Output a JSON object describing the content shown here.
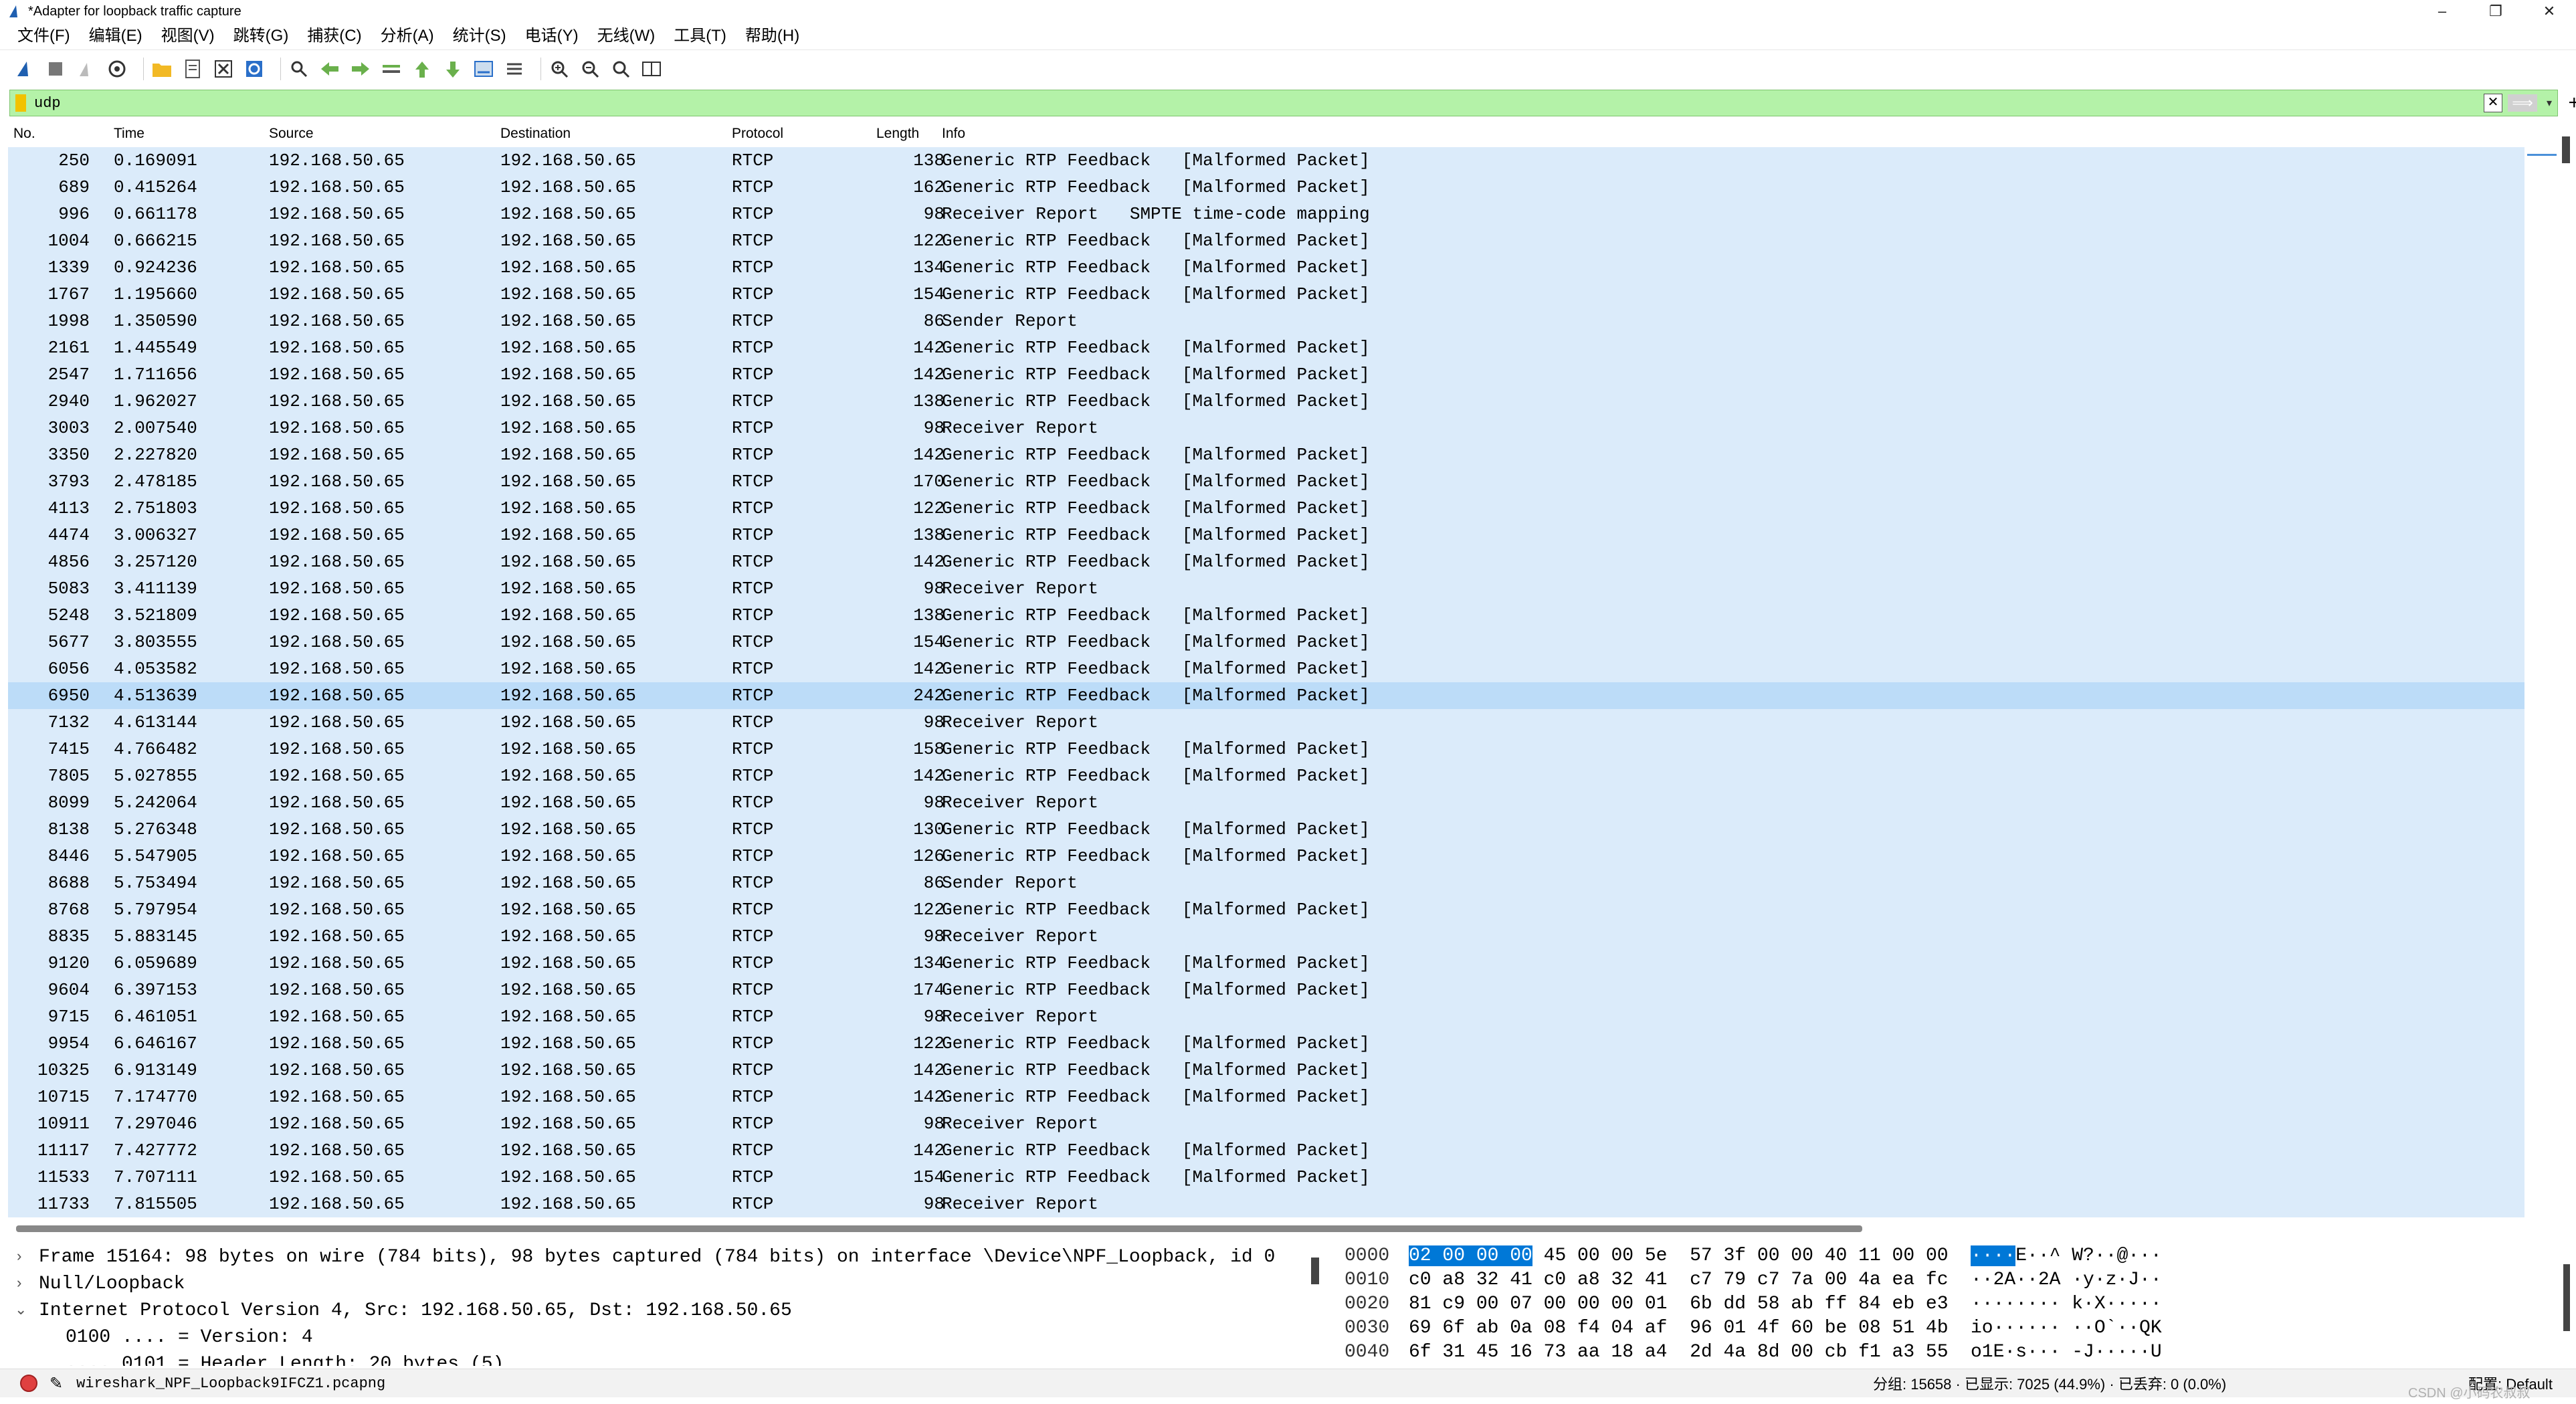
{
  "window": {
    "title": "*Adapter for loopback traffic capture",
    "controls": [
      "–",
      "❐",
      "✕"
    ]
  },
  "menu": [
    "文件(F)",
    "编辑(E)",
    "视图(V)",
    "跳转(G)",
    "捕获(C)",
    "分析(A)",
    "统计(S)",
    "电话(Y)",
    "无线(W)",
    "工具(T)",
    "帮助(H)"
  ],
  "filter": {
    "value": "udp",
    "clear": "✕",
    "apply": "⟹",
    "dropdown": "▾",
    "add": "+"
  },
  "columns": {
    "no": "No.",
    "time": "Time",
    "source": "Source",
    "destination": "Destination",
    "protocol": "Protocol",
    "length": "Length",
    "info": "Info"
  },
  "packets": [
    {
      "no": "250",
      "time": "0.169091",
      "src": "192.168.50.65",
      "dst": "192.168.50.65",
      "proto": "RTCP",
      "len": "138",
      "info": "Generic RTP Feedback   [Malformed Packet]"
    },
    {
      "no": "689",
      "time": "0.415264",
      "src": "192.168.50.65",
      "dst": "192.168.50.65",
      "proto": "RTCP",
      "len": "162",
      "info": "Generic RTP Feedback   [Malformed Packet]"
    },
    {
      "no": "996",
      "time": "0.661178",
      "src": "192.168.50.65",
      "dst": "192.168.50.65",
      "proto": "RTCP",
      "len": "98",
      "info": "Receiver Report   SMPTE time-code mapping"
    },
    {
      "no": "1004",
      "time": "0.666215",
      "src": "192.168.50.65",
      "dst": "192.168.50.65",
      "proto": "RTCP",
      "len": "122",
      "info": "Generic RTP Feedback   [Malformed Packet]"
    },
    {
      "no": "1339",
      "time": "0.924236",
      "src": "192.168.50.65",
      "dst": "192.168.50.65",
      "proto": "RTCP",
      "len": "134",
      "info": "Generic RTP Feedback   [Malformed Packet]"
    },
    {
      "no": "1767",
      "time": "1.195660",
      "src": "192.168.50.65",
      "dst": "192.168.50.65",
      "proto": "RTCP",
      "len": "154",
      "info": "Generic RTP Feedback   [Malformed Packet]"
    },
    {
      "no": "1998",
      "time": "1.350590",
      "src": "192.168.50.65",
      "dst": "192.168.50.65",
      "proto": "RTCP",
      "len": "86",
      "info": "Sender Report"
    },
    {
      "no": "2161",
      "time": "1.445549",
      "src": "192.168.50.65",
      "dst": "192.168.50.65",
      "proto": "RTCP",
      "len": "142",
      "info": "Generic RTP Feedback   [Malformed Packet]"
    },
    {
      "no": "2547",
      "time": "1.711656",
      "src": "192.168.50.65",
      "dst": "192.168.50.65",
      "proto": "RTCP",
      "len": "142",
      "info": "Generic RTP Feedback   [Malformed Packet]"
    },
    {
      "no": "2940",
      "time": "1.962027",
      "src": "192.168.50.65",
      "dst": "192.168.50.65",
      "proto": "RTCP",
      "len": "138",
      "info": "Generic RTP Feedback   [Malformed Packet]"
    },
    {
      "no": "3003",
      "time": "2.007540",
      "src": "192.168.50.65",
      "dst": "192.168.50.65",
      "proto": "RTCP",
      "len": "98",
      "info": "Receiver Report"
    },
    {
      "no": "3350",
      "time": "2.227820",
      "src": "192.168.50.65",
      "dst": "192.168.50.65",
      "proto": "RTCP",
      "len": "142",
      "info": "Generic RTP Feedback   [Malformed Packet]"
    },
    {
      "no": "3793",
      "time": "2.478185",
      "src": "192.168.50.65",
      "dst": "192.168.50.65",
      "proto": "RTCP",
      "len": "170",
      "info": "Generic RTP Feedback   [Malformed Packet]"
    },
    {
      "no": "4113",
      "time": "2.751803",
      "src": "192.168.50.65",
      "dst": "192.168.50.65",
      "proto": "RTCP",
      "len": "122",
      "info": "Generic RTP Feedback   [Malformed Packet]"
    },
    {
      "no": "4474",
      "time": "3.006327",
      "src": "192.168.50.65",
      "dst": "192.168.50.65",
      "proto": "RTCP",
      "len": "138",
      "info": "Generic RTP Feedback   [Malformed Packet]"
    },
    {
      "no": "4856",
      "time": "3.257120",
      "src": "192.168.50.65",
      "dst": "192.168.50.65",
      "proto": "RTCP",
      "len": "142",
      "info": "Generic RTP Feedback   [Malformed Packet]"
    },
    {
      "no": "5083",
      "time": "3.411139",
      "src": "192.168.50.65",
      "dst": "192.168.50.65",
      "proto": "RTCP",
      "len": "98",
      "info": "Receiver Report"
    },
    {
      "no": "5248",
      "time": "3.521809",
      "src": "192.168.50.65",
      "dst": "192.168.50.65",
      "proto": "RTCP",
      "len": "138",
      "info": "Generic RTP Feedback   [Malformed Packet]"
    },
    {
      "no": "5677",
      "time": "3.803555",
      "src": "192.168.50.65",
      "dst": "192.168.50.65",
      "proto": "RTCP",
      "len": "154",
      "info": "Generic RTP Feedback   [Malformed Packet]"
    },
    {
      "no": "6056",
      "time": "4.053582",
      "src": "192.168.50.65",
      "dst": "192.168.50.65",
      "proto": "RTCP",
      "len": "142",
      "info": "Generic RTP Feedback   [Malformed Packet]"
    },
    {
      "no": "6950",
      "time": "4.513639",
      "src": "192.168.50.65",
      "dst": "192.168.50.65",
      "proto": "RTCP",
      "len": "242",
      "info": "Generic RTP Feedback   [Malformed Packet]",
      "selected": true
    },
    {
      "no": "7132",
      "time": "4.613144",
      "src": "192.168.50.65",
      "dst": "192.168.50.65",
      "proto": "RTCP",
      "len": "98",
      "info": "Receiver Report"
    },
    {
      "no": "7415",
      "time": "4.766482",
      "src": "192.168.50.65",
      "dst": "192.168.50.65",
      "proto": "RTCP",
      "len": "158",
      "info": "Generic RTP Feedback   [Malformed Packet]"
    },
    {
      "no": "7805",
      "time": "5.027855",
      "src": "192.168.50.65",
      "dst": "192.168.50.65",
      "proto": "RTCP",
      "len": "142",
      "info": "Generic RTP Feedback   [Malformed Packet]"
    },
    {
      "no": "8099",
      "time": "5.242064",
      "src": "192.168.50.65",
      "dst": "192.168.50.65",
      "proto": "RTCP",
      "len": "98",
      "info": "Receiver Report"
    },
    {
      "no": "8138",
      "time": "5.276348",
      "src": "192.168.50.65",
      "dst": "192.168.50.65",
      "proto": "RTCP",
      "len": "130",
      "info": "Generic RTP Feedback   [Malformed Packet]"
    },
    {
      "no": "8446",
      "time": "5.547905",
      "src": "192.168.50.65",
      "dst": "192.168.50.65",
      "proto": "RTCP",
      "len": "126",
      "info": "Generic RTP Feedback   [Malformed Packet]"
    },
    {
      "no": "8688",
      "time": "5.753494",
      "src": "192.168.50.65",
      "dst": "192.168.50.65",
      "proto": "RTCP",
      "len": "86",
      "info": "Sender Report"
    },
    {
      "no": "8768",
      "time": "5.797954",
      "src": "192.168.50.65",
      "dst": "192.168.50.65",
      "proto": "RTCP",
      "len": "122",
      "info": "Generic RTP Feedback   [Malformed Packet]"
    },
    {
      "no": "8835",
      "time": "5.883145",
      "src": "192.168.50.65",
      "dst": "192.168.50.65",
      "proto": "RTCP",
      "len": "98",
      "info": "Receiver Report"
    },
    {
      "no": "9120",
      "time": "6.059689",
      "src": "192.168.50.65",
      "dst": "192.168.50.65",
      "proto": "RTCP",
      "len": "134",
      "info": "Generic RTP Feedback   [Malformed Packet]"
    },
    {
      "no": "9604",
      "time": "6.397153",
      "src": "192.168.50.65",
      "dst": "192.168.50.65",
      "proto": "RTCP",
      "len": "174",
      "info": "Generic RTP Feedback   [Malformed Packet]"
    },
    {
      "no": "9715",
      "time": "6.461051",
      "src": "192.168.50.65",
      "dst": "192.168.50.65",
      "proto": "RTCP",
      "len": "98",
      "info": "Receiver Report"
    },
    {
      "no": "9954",
      "time": "6.646167",
      "src": "192.168.50.65",
      "dst": "192.168.50.65",
      "proto": "RTCP",
      "len": "122",
      "info": "Generic RTP Feedback   [Malformed Packet]"
    },
    {
      "no": "10325",
      "time": "6.913149",
      "src": "192.168.50.65",
      "dst": "192.168.50.65",
      "proto": "RTCP",
      "len": "142",
      "info": "Generic RTP Feedback   [Malformed Packet]"
    },
    {
      "no": "10715",
      "time": "7.174770",
      "src": "192.168.50.65",
      "dst": "192.168.50.65",
      "proto": "RTCP",
      "len": "142",
      "info": "Generic RTP Feedback   [Malformed Packet]"
    },
    {
      "no": "10911",
      "time": "7.297046",
      "src": "192.168.50.65",
      "dst": "192.168.50.65",
      "proto": "RTCP",
      "len": "98",
      "info": "Receiver Report"
    },
    {
      "no": "11117",
      "time": "7.427772",
      "src": "192.168.50.65",
      "dst": "192.168.50.65",
      "proto": "RTCP",
      "len": "142",
      "info": "Generic RTP Feedback   [Malformed Packet]"
    },
    {
      "no": "11533",
      "time": "7.707111",
      "src": "192.168.50.65",
      "dst": "192.168.50.65",
      "proto": "RTCP",
      "len": "154",
      "info": "Generic RTP Feedback   [Malformed Packet]"
    },
    {
      "no": "11733",
      "time": "7.815505",
      "src": "192.168.50.65",
      "dst": "192.168.50.65",
      "proto": "RTCP",
      "len": "98",
      "info": "Receiver Report"
    }
  ],
  "details": [
    {
      "chev": "›",
      "text": "Frame 15164: 98 bytes on wire (784 bits), 98 bytes captured (784 bits) on interface \\Device\\NPF_Loopback, id 0",
      "sub": false
    },
    {
      "chev": "›",
      "text": "Null/Loopback",
      "sub": false
    },
    {
      "chev": "⌄",
      "text": "Internet Protocol Version 4, Src: 192.168.50.65, Dst: 192.168.50.65",
      "sub": false
    },
    {
      "chev": "",
      "text": "0100 .... = Version: 4",
      "sub": true
    },
    {
      "chev": "",
      "text": ".... 0101 = Header Length: 20 bytes (5)",
      "sub": true
    }
  ],
  "bytes": [
    {
      "off": "0000",
      "hl_hex": "02 00 00 00",
      "hex": " 45 00 00 5e  57 3f 00 00 40 11 00 00",
      "hl_asc": "····",
      "asc": "E··^ W?··@···"
    },
    {
      "off": "0010",
      "hl_hex": "",
      "hex": "c0 a8 32 41 c0 a8 32 41  c7 79 c7 7a 00 4a ea fc",
      "hl_asc": "",
      "asc": "··2A··2A ·y·z·J··"
    },
    {
      "off": "0020",
      "hl_hex": "",
      "hex": "81 c9 00 07 00 00 00 01  6b dd 58 ab ff 84 eb e3",
      "hl_asc": "",
      "asc": "········ k·X·····"
    },
    {
      "off": "0030",
      "hl_hex": "",
      "hex": "69 6f ab 0a 08 f4 04 af  96 01 4f 60 be 08 51 4b",
      "hl_asc": "",
      "asc": "io······ ··O`··QK"
    },
    {
      "off": "0040",
      "hl_hex": "",
      "hex": "6f 31 45 16 73 aa 18 a4  2d 4a 8d 00 cb f1 a3 55",
      "hl_asc": "",
      "asc": "o1E·s··· -J·····U"
    }
  ],
  "status": {
    "file": "wireshark_NPF_Loopback9IFCZ1.pcapng",
    "stats": "分组: 15658 · 已显示: 7025 (44.9%) · 已丢弃: 0 (0.0%)",
    "profile": "配置: Default",
    "watermark": "CSDN @小码农叔叔"
  }
}
